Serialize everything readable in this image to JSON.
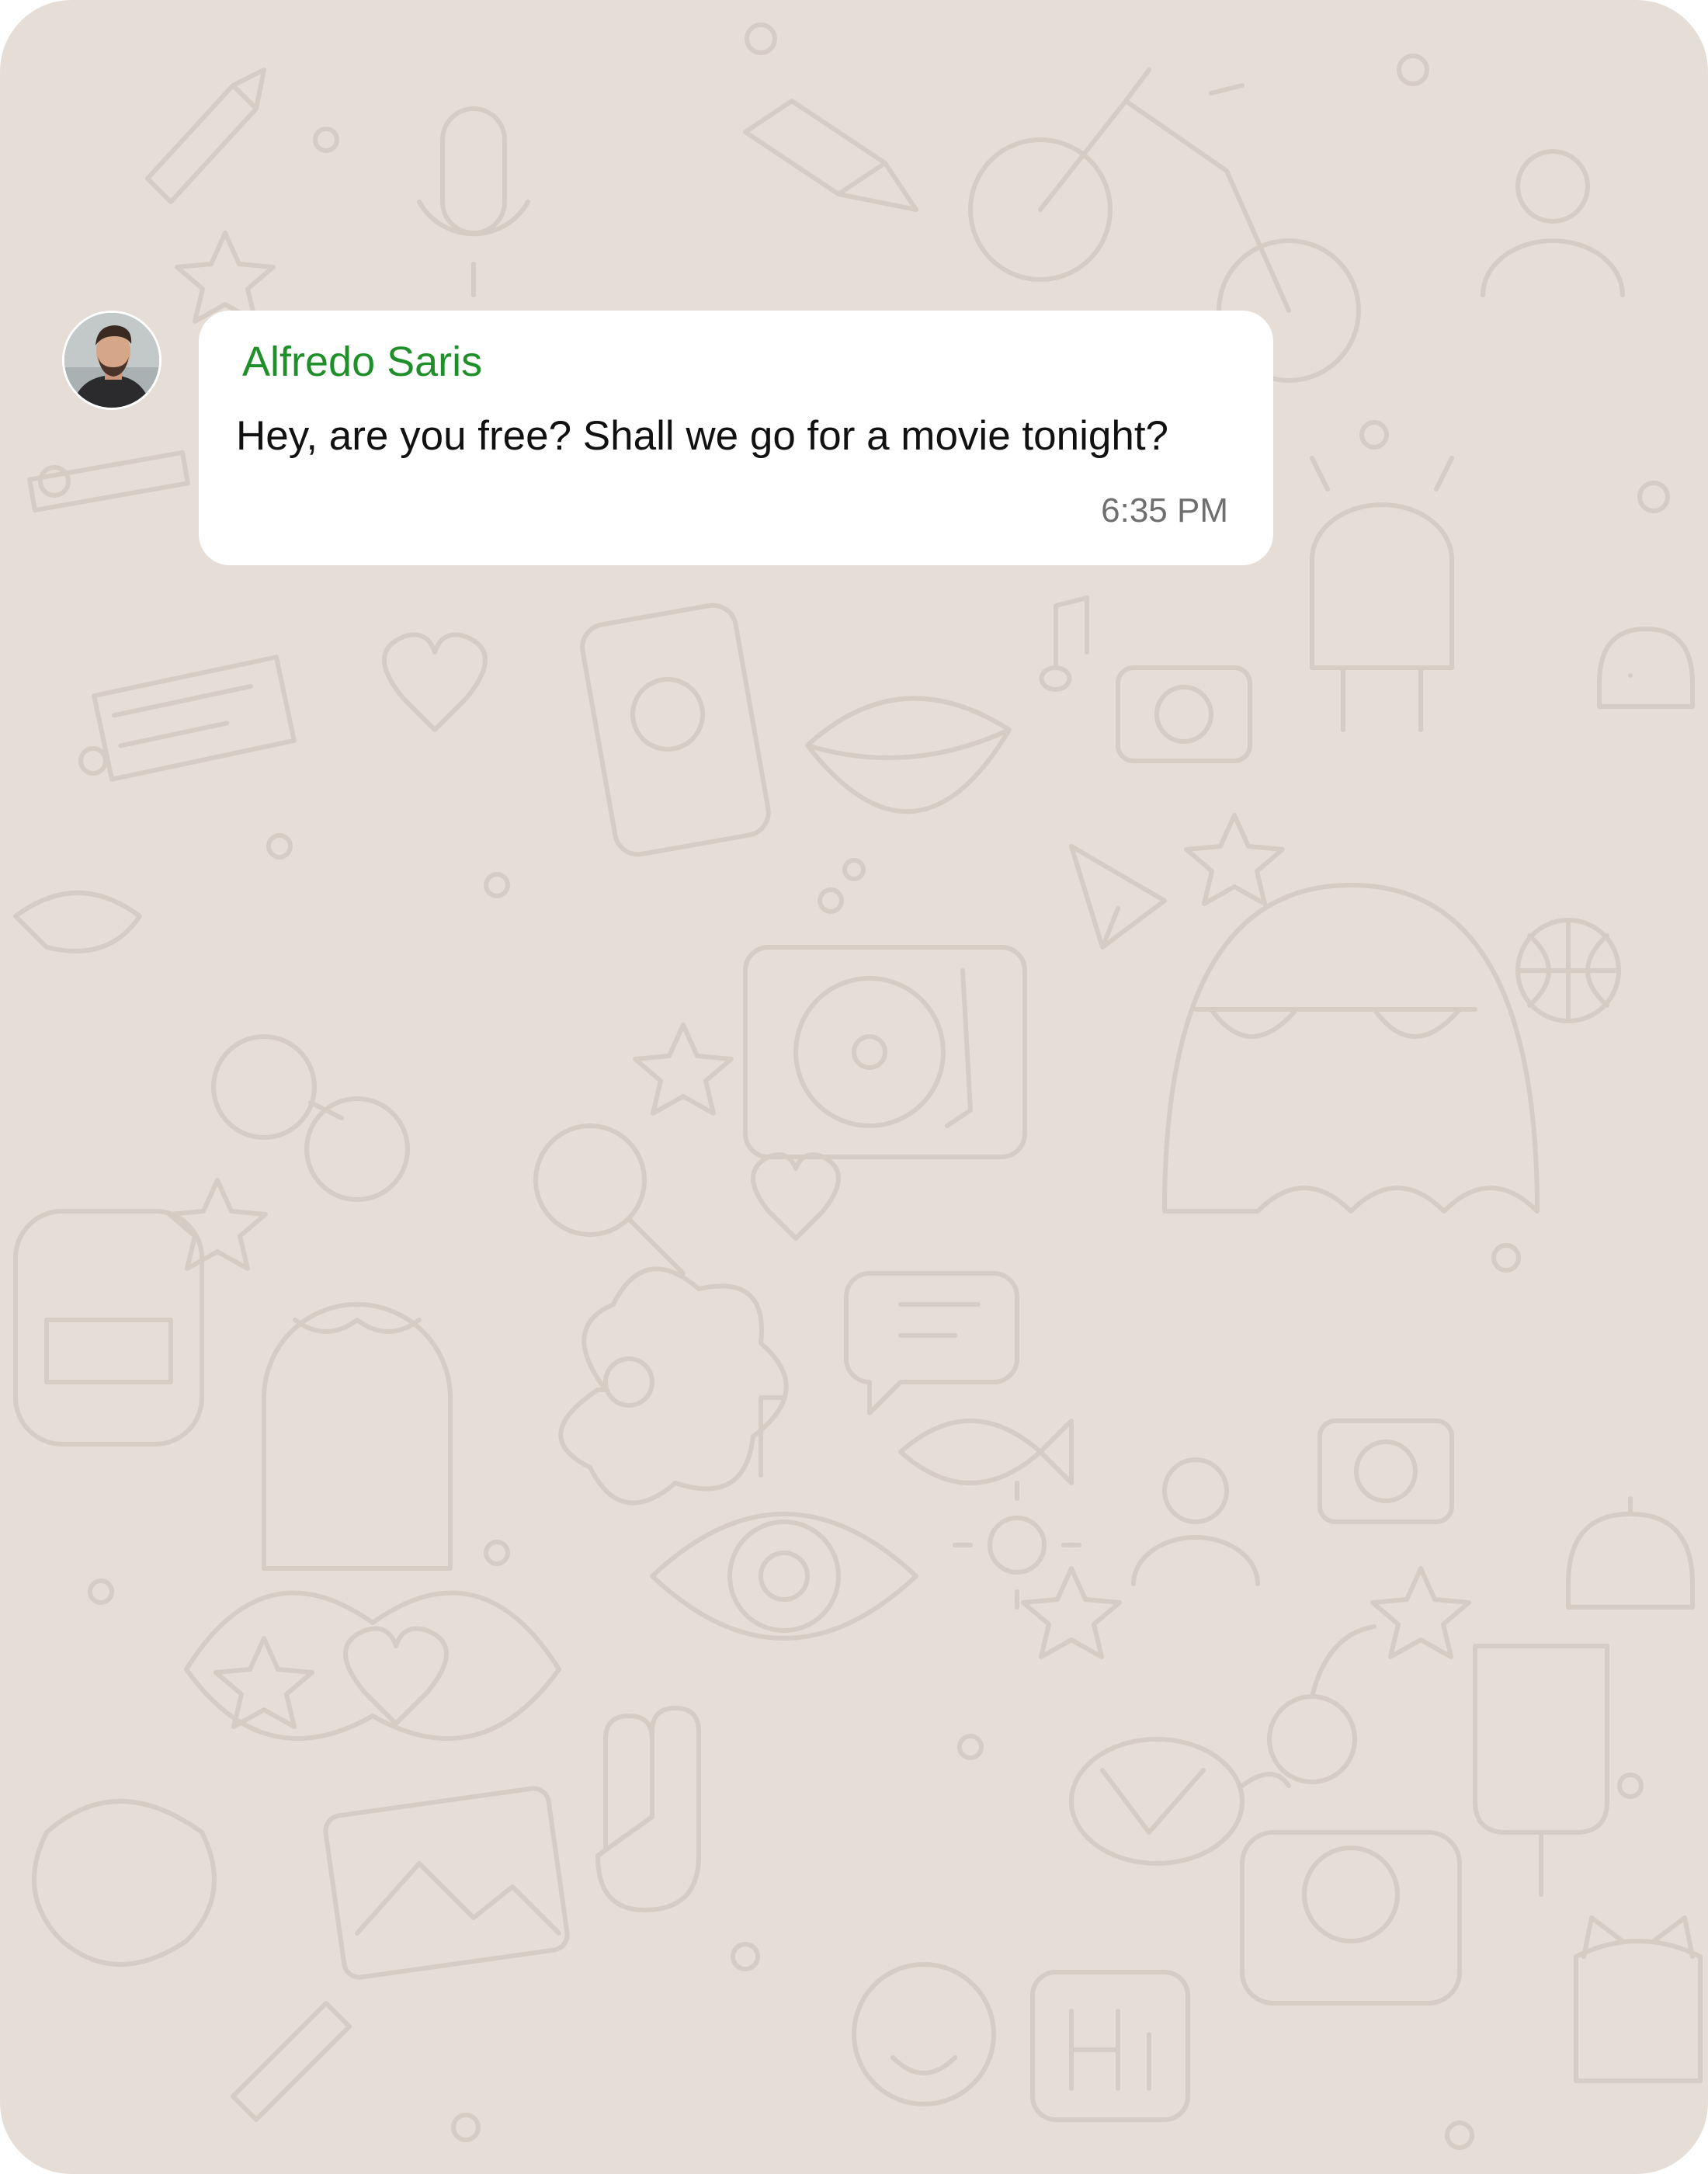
{
  "chat": {
    "background_color": "#e6ddd6",
    "wallpaper_color": "#d6ccc4",
    "message": {
      "sender_name": "Alfredo Saris",
      "sender_color": "#1f8f2a",
      "text": "Hey, are you free? Shall we go for a movie tonight?",
      "time": "6:35 PM"
    },
    "avatar_icon": "user-photo"
  }
}
